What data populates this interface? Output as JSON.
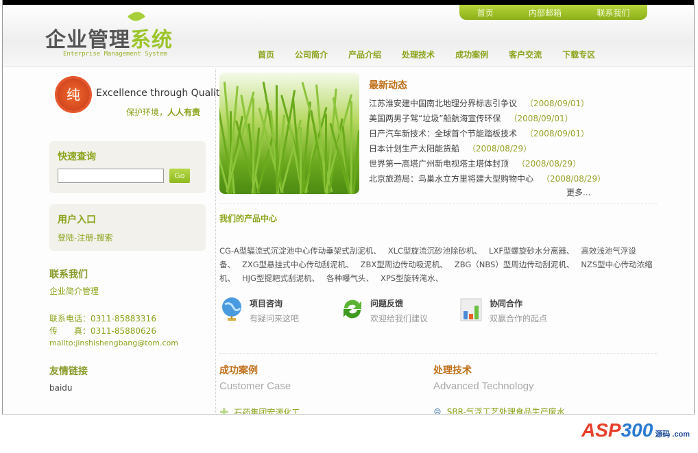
{
  "header": {
    "logo_dark": "企业管理",
    "logo_green": "系统",
    "logo_sub": "Enterprise Management System",
    "top_links": [
      "首页",
      "内部邮箱",
      "联系我们"
    ],
    "nav": [
      "首页",
      "公司简介",
      "产品介绍",
      "处理技术",
      "成功案例",
      "客户交流",
      "下载专区"
    ]
  },
  "left": {
    "badge": "纯",
    "tagline": "Excellence through Quality",
    "slogan_a": "保护环境，",
    "slogan_b": "人人有责",
    "quick_search": {
      "title": "快速查询",
      "value": "",
      "go": "Go"
    },
    "user": {
      "title": "用户入口",
      "links": "登陆-注册-搜索"
    },
    "contact": {
      "title": "联系我们",
      "company": "企业简介管理",
      "phone": "联系电话：0311-85883316",
      "fax": "传　　真：0311-85880626",
      "mail": "mailto:jinshishengbang@tom.com"
    },
    "friends": {
      "title": "友情链接",
      "items": [
        "baidu"
      ]
    }
  },
  "news": {
    "title": "最新动态",
    "items": [
      {
        "t": "江苏淮安建中国南北地理分界标志引争议",
        "d": "（2008/09/01）"
      },
      {
        "t": "美国两男子驾“垃圾”船航海宣传环保",
        "d": "（2008/09/01）"
      },
      {
        "t": "日产汽车新技术：全球首个节能踏板技术",
        "d": "（2008/09/01）"
      },
      {
        "t": "日本计划生产太阳能货船",
        "d": "（2008/08/29）"
      },
      {
        "t": "世界第一高塔广州新电视塔主塔体封顶",
        "d": "（2008/08/29）"
      },
      {
        "t": "北京旅游局：鸟巢水立方里将建大型购物中心",
        "d": "（2008/08/29）"
      }
    ],
    "more": "更多..."
  },
  "products": {
    "title": "我们的产品中心",
    "items": [
      "CG-A型辐流式沉淀池中心传动垂架式刮泥机、",
      "XLC型旋流沉砂池除砂机、",
      "LXF型螺旋砂水分离器、",
      "高效浅池气浮设备、",
      "ZXG型悬挂式中心传动刮泥机、",
      "ZBX型周边传动吸泥机、",
      "ZBG（NBS）型周边传动刮泥机、",
      "NZS型中心传动浓缩机、",
      "HJG型提耙式刮泥机、",
      "各种曝气头、",
      "XPS型旋转滗水、"
    ]
  },
  "features": [
    {
      "title": "项目咨询",
      "sub": "有疑问来这吧",
      "icon": "globe-icon"
    },
    {
      "title": "问题反馈",
      "sub": "欢迎给我们建议",
      "icon": "refresh-icon"
    },
    {
      "title": "协同合作",
      "sub": "双赢合作的起点",
      "icon": "bar-chart-icon"
    }
  ],
  "cases": {
    "title": "成功案例",
    "en": "Customer Case",
    "items": [
      "石药集团宏源化工"
    ]
  },
  "tech": {
    "title": "处理技术",
    "en": "Advanced Technology",
    "items": [
      "SBR-气浮工艺处理食品生产废水"
    ]
  },
  "watermark": {
    "a": "ASP",
    "b": "300",
    "c": "源码",
    ".com": ".com"
  }
}
